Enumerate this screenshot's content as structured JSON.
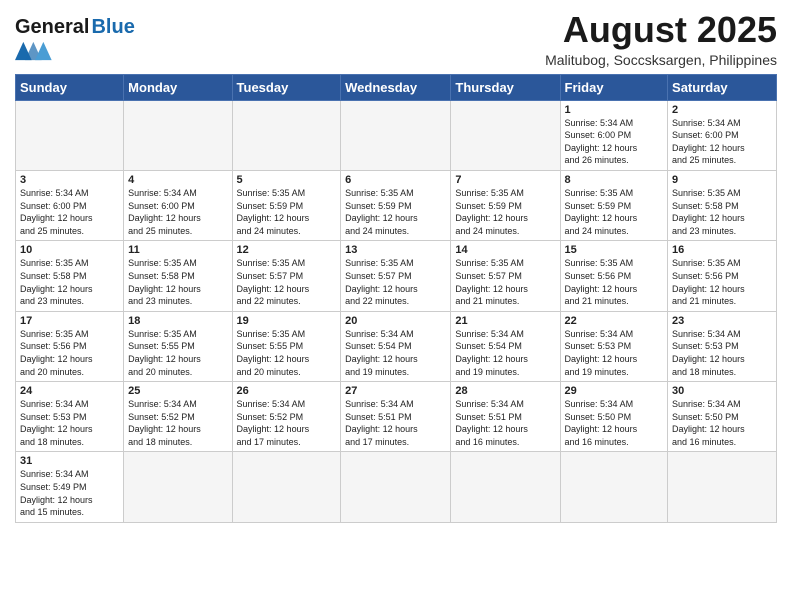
{
  "header": {
    "logo_general": "General",
    "logo_blue": "Blue",
    "month_title": "August 2025",
    "subtitle": "Malitubog, Soccsksargen, Philippines"
  },
  "days_of_week": [
    "Sunday",
    "Monday",
    "Tuesday",
    "Wednesday",
    "Thursday",
    "Friday",
    "Saturday"
  ],
  "weeks": [
    [
      {
        "day": "",
        "info": ""
      },
      {
        "day": "",
        "info": ""
      },
      {
        "day": "",
        "info": ""
      },
      {
        "day": "",
        "info": ""
      },
      {
        "day": "",
        "info": ""
      },
      {
        "day": "1",
        "info": "Sunrise: 5:34 AM\nSunset: 6:00 PM\nDaylight: 12 hours\nand 26 minutes."
      },
      {
        "day": "2",
        "info": "Sunrise: 5:34 AM\nSunset: 6:00 PM\nDaylight: 12 hours\nand 25 minutes."
      }
    ],
    [
      {
        "day": "3",
        "info": "Sunrise: 5:34 AM\nSunset: 6:00 PM\nDaylight: 12 hours\nand 25 minutes."
      },
      {
        "day": "4",
        "info": "Sunrise: 5:34 AM\nSunset: 6:00 PM\nDaylight: 12 hours\nand 25 minutes."
      },
      {
        "day": "5",
        "info": "Sunrise: 5:35 AM\nSunset: 5:59 PM\nDaylight: 12 hours\nand 24 minutes."
      },
      {
        "day": "6",
        "info": "Sunrise: 5:35 AM\nSunset: 5:59 PM\nDaylight: 12 hours\nand 24 minutes."
      },
      {
        "day": "7",
        "info": "Sunrise: 5:35 AM\nSunset: 5:59 PM\nDaylight: 12 hours\nand 24 minutes."
      },
      {
        "day": "8",
        "info": "Sunrise: 5:35 AM\nSunset: 5:59 PM\nDaylight: 12 hours\nand 24 minutes."
      },
      {
        "day": "9",
        "info": "Sunrise: 5:35 AM\nSunset: 5:58 PM\nDaylight: 12 hours\nand 23 minutes."
      }
    ],
    [
      {
        "day": "10",
        "info": "Sunrise: 5:35 AM\nSunset: 5:58 PM\nDaylight: 12 hours\nand 23 minutes."
      },
      {
        "day": "11",
        "info": "Sunrise: 5:35 AM\nSunset: 5:58 PM\nDaylight: 12 hours\nand 23 minutes."
      },
      {
        "day": "12",
        "info": "Sunrise: 5:35 AM\nSunset: 5:57 PM\nDaylight: 12 hours\nand 22 minutes."
      },
      {
        "day": "13",
        "info": "Sunrise: 5:35 AM\nSunset: 5:57 PM\nDaylight: 12 hours\nand 22 minutes."
      },
      {
        "day": "14",
        "info": "Sunrise: 5:35 AM\nSunset: 5:57 PM\nDaylight: 12 hours\nand 21 minutes."
      },
      {
        "day": "15",
        "info": "Sunrise: 5:35 AM\nSunset: 5:56 PM\nDaylight: 12 hours\nand 21 minutes."
      },
      {
        "day": "16",
        "info": "Sunrise: 5:35 AM\nSunset: 5:56 PM\nDaylight: 12 hours\nand 21 minutes."
      }
    ],
    [
      {
        "day": "17",
        "info": "Sunrise: 5:35 AM\nSunset: 5:56 PM\nDaylight: 12 hours\nand 20 minutes."
      },
      {
        "day": "18",
        "info": "Sunrise: 5:35 AM\nSunset: 5:55 PM\nDaylight: 12 hours\nand 20 minutes."
      },
      {
        "day": "19",
        "info": "Sunrise: 5:35 AM\nSunset: 5:55 PM\nDaylight: 12 hours\nand 20 minutes."
      },
      {
        "day": "20",
        "info": "Sunrise: 5:34 AM\nSunset: 5:54 PM\nDaylight: 12 hours\nand 19 minutes."
      },
      {
        "day": "21",
        "info": "Sunrise: 5:34 AM\nSunset: 5:54 PM\nDaylight: 12 hours\nand 19 minutes."
      },
      {
        "day": "22",
        "info": "Sunrise: 5:34 AM\nSunset: 5:53 PM\nDaylight: 12 hours\nand 19 minutes."
      },
      {
        "day": "23",
        "info": "Sunrise: 5:34 AM\nSunset: 5:53 PM\nDaylight: 12 hours\nand 18 minutes."
      }
    ],
    [
      {
        "day": "24",
        "info": "Sunrise: 5:34 AM\nSunset: 5:53 PM\nDaylight: 12 hours\nand 18 minutes."
      },
      {
        "day": "25",
        "info": "Sunrise: 5:34 AM\nSunset: 5:52 PM\nDaylight: 12 hours\nand 18 minutes."
      },
      {
        "day": "26",
        "info": "Sunrise: 5:34 AM\nSunset: 5:52 PM\nDaylight: 12 hours\nand 17 minutes."
      },
      {
        "day": "27",
        "info": "Sunrise: 5:34 AM\nSunset: 5:51 PM\nDaylight: 12 hours\nand 17 minutes."
      },
      {
        "day": "28",
        "info": "Sunrise: 5:34 AM\nSunset: 5:51 PM\nDaylight: 12 hours\nand 16 minutes."
      },
      {
        "day": "29",
        "info": "Sunrise: 5:34 AM\nSunset: 5:50 PM\nDaylight: 12 hours\nand 16 minutes."
      },
      {
        "day": "30",
        "info": "Sunrise: 5:34 AM\nSunset: 5:50 PM\nDaylight: 12 hours\nand 16 minutes."
      }
    ],
    [
      {
        "day": "31",
        "info": "Sunrise: 5:34 AM\nSunset: 5:49 PM\nDaylight: 12 hours\nand 15 minutes."
      },
      {
        "day": "",
        "info": ""
      },
      {
        "day": "",
        "info": ""
      },
      {
        "day": "",
        "info": ""
      },
      {
        "day": "",
        "info": ""
      },
      {
        "day": "",
        "info": ""
      },
      {
        "day": "",
        "info": ""
      }
    ]
  ]
}
